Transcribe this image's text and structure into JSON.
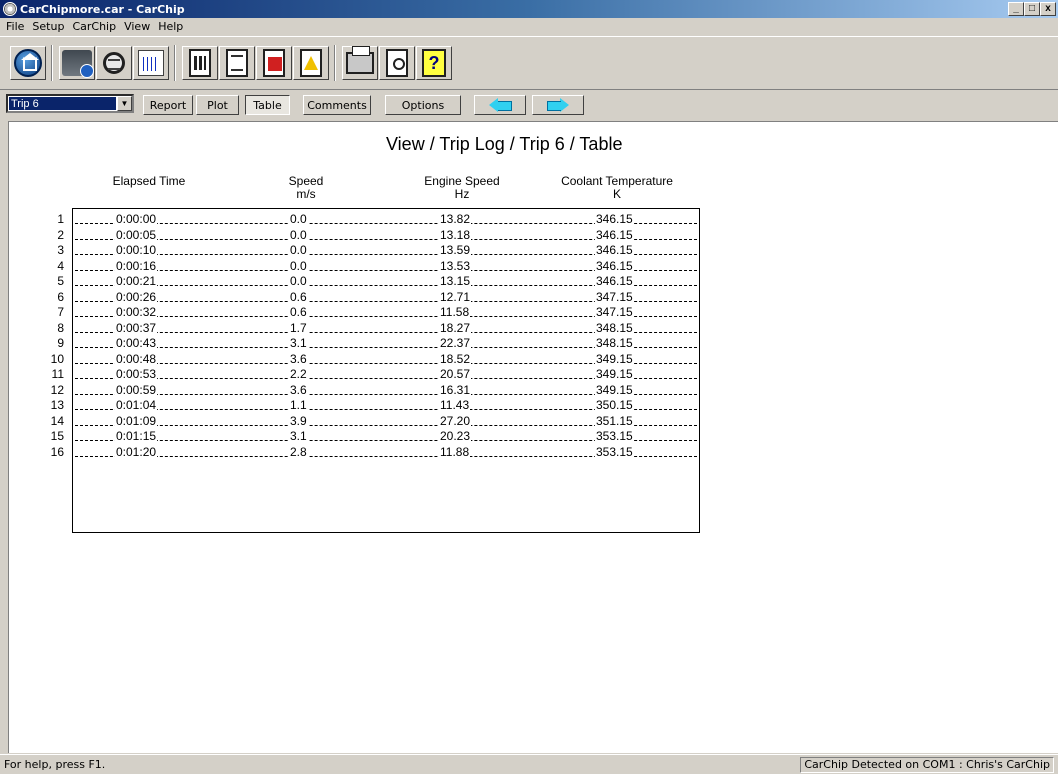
{
  "window": {
    "title": "CarChipmore.car - CarChip",
    "controls": [
      "_",
      "□",
      "x"
    ]
  },
  "menu": [
    "File",
    "Setup",
    "CarChip",
    "View",
    "Help"
  ],
  "toolbar": {
    "icons": [
      "home-icon",
      "car-download-icon",
      "magnifier-icon",
      "graph-icon",
      "film-report-icon",
      "document-icon",
      "alert-report-icon",
      "warning-report-icon",
      "printer-icon",
      "print-preview-icon",
      "help-icon"
    ],
    "help_glyph": "?"
  },
  "nav": {
    "trip_selected": "Trip 6",
    "buttons": {
      "report": "Report",
      "plot": "Plot",
      "table": "Table",
      "comments": "Comments",
      "options": "Options"
    }
  },
  "view": {
    "title": "View / Trip Log / Trip 6 / Table",
    "columns": [
      {
        "name": "Elapsed Time",
        "unit": ""
      },
      {
        "name": "Speed",
        "unit": "m/s"
      },
      {
        "name": "Engine Speed",
        "unit": "Hz"
      },
      {
        "name": "Coolant Temperature",
        "unit": "K"
      }
    ],
    "rows": [
      {
        "n": "1",
        "time": "0:00:00",
        "speed": "0.0",
        "engine": "13.82",
        "coolant": "346.15"
      },
      {
        "n": "2",
        "time": "0:00:05",
        "speed": "0.0",
        "engine": "13.18",
        "coolant": "346.15"
      },
      {
        "n": "3",
        "time": "0:00:10",
        "speed": "0.0",
        "engine": "13.59",
        "coolant": "346.15"
      },
      {
        "n": "4",
        "time": "0:00:16",
        "speed": "0.0",
        "engine": "13.53",
        "coolant": "346.15"
      },
      {
        "n": "5",
        "time": "0:00:21",
        "speed": "0.0",
        "engine": "13.15",
        "coolant": "346.15"
      },
      {
        "n": "6",
        "time": "0:00:26",
        "speed": "0.6",
        "engine": "12.71",
        "coolant": "347.15"
      },
      {
        "n": "7",
        "time": "0:00:32",
        "speed": "0.6",
        "engine": "11.58",
        "coolant": "347.15"
      },
      {
        "n": "8",
        "time": "0:00:37",
        "speed": "1.7",
        "engine": "18.27",
        "coolant": "348.15"
      },
      {
        "n": "9",
        "time": "0:00:43",
        "speed": "3.1",
        "engine": "22.37",
        "coolant": "348.15"
      },
      {
        "n": "10",
        "time": "0:00:48",
        "speed": "3.6",
        "engine": "18.52",
        "coolant": "349.15"
      },
      {
        "n": "11",
        "time": "0:00:53",
        "speed": "2.2",
        "engine": "20.57",
        "coolant": "349.15"
      },
      {
        "n": "12",
        "time": "0:00:59",
        "speed": "3.6",
        "engine": "16.31",
        "coolant": "349.15"
      },
      {
        "n": "13",
        "time": "0:01:04",
        "speed": "1.1",
        "engine": "11.43",
        "coolant": "350.15"
      },
      {
        "n": "14",
        "time": "0:01:09",
        "speed": "3.9",
        "engine": "27.20",
        "coolant": "351.15"
      },
      {
        "n": "15",
        "time": "0:01:15",
        "speed": "3.1",
        "engine": "20.23",
        "coolant": "353.15"
      },
      {
        "n": "16",
        "time": "0:01:20",
        "speed": "2.8",
        "engine": "11.88",
        "coolant": "353.15"
      }
    ]
  },
  "status": {
    "help": "For help, press F1.",
    "device": "CarChip Detected on COM1 : Chris's CarChip"
  }
}
